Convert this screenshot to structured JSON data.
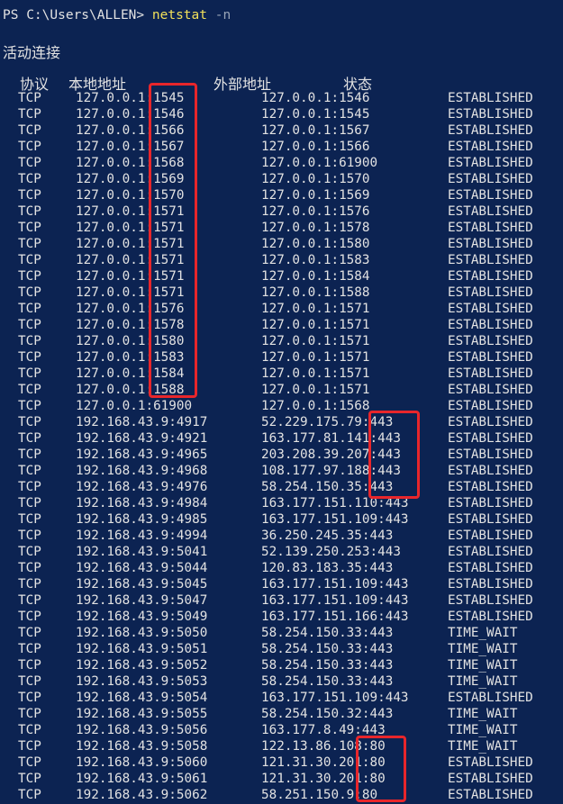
{
  "prompt": {
    "path": "PS C:\\Users\\ALLEN> ",
    "command": "netstat",
    "option": " -n"
  },
  "section_title": "活动连接",
  "headers": {
    "proto": "协议",
    "local": "本地地址",
    "foreign": "外部地址",
    "state": "状态"
  },
  "rows": [
    [
      "TCP",
      "127.0.0.1:1545",
      "127.0.0.1:1546",
      "ESTABLISHED"
    ],
    [
      "TCP",
      "127.0.0.1:1546",
      "127.0.0.1:1545",
      "ESTABLISHED"
    ],
    [
      "TCP",
      "127.0.0.1:1566",
      "127.0.0.1:1567",
      "ESTABLISHED"
    ],
    [
      "TCP",
      "127.0.0.1:1567",
      "127.0.0.1:1566",
      "ESTABLISHED"
    ],
    [
      "TCP",
      "127.0.0.1:1568",
      "127.0.0.1:61900",
      "ESTABLISHED"
    ],
    [
      "TCP",
      "127.0.0.1:1569",
      "127.0.0.1:1570",
      "ESTABLISHED"
    ],
    [
      "TCP",
      "127.0.0.1:1570",
      "127.0.0.1:1569",
      "ESTABLISHED"
    ],
    [
      "TCP",
      "127.0.0.1:1571",
      "127.0.0.1:1576",
      "ESTABLISHED"
    ],
    [
      "TCP",
      "127.0.0.1:1571",
      "127.0.0.1:1578",
      "ESTABLISHED"
    ],
    [
      "TCP",
      "127.0.0.1:1571",
      "127.0.0.1:1580",
      "ESTABLISHED"
    ],
    [
      "TCP",
      "127.0.0.1:1571",
      "127.0.0.1:1583",
      "ESTABLISHED"
    ],
    [
      "TCP",
      "127.0.0.1:1571",
      "127.0.0.1:1584",
      "ESTABLISHED"
    ],
    [
      "TCP",
      "127.0.0.1:1571",
      "127.0.0.1:1588",
      "ESTABLISHED"
    ],
    [
      "TCP",
      "127.0.0.1:1576",
      "127.0.0.1:1571",
      "ESTABLISHED"
    ],
    [
      "TCP",
      "127.0.0.1:1578",
      "127.0.0.1:1571",
      "ESTABLISHED"
    ],
    [
      "TCP",
      "127.0.0.1:1580",
      "127.0.0.1:1571",
      "ESTABLISHED"
    ],
    [
      "TCP",
      "127.0.0.1:1583",
      "127.0.0.1:1571",
      "ESTABLISHED"
    ],
    [
      "TCP",
      "127.0.0.1:1584",
      "127.0.0.1:1571",
      "ESTABLISHED"
    ],
    [
      "TCP",
      "127.0.0.1:1588",
      "127.0.0.1:1571",
      "ESTABLISHED"
    ],
    [
      "TCP",
      "127.0.0.1:61900",
      "127.0.0.1:1568",
      "ESTABLISHED"
    ],
    [
      "TCP",
      "192.168.43.9:4917",
      "52.229.175.79:443",
      "ESTABLISHED"
    ],
    [
      "TCP",
      "192.168.43.9:4921",
      "163.177.81.141:443",
      "ESTABLISHED"
    ],
    [
      "TCP",
      "192.168.43.9:4965",
      "203.208.39.207:443",
      "ESTABLISHED"
    ],
    [
      "TCP",
      "192.168.43.9:4968",
      "108.177.97.188:443",
      "ESTABLISHED"
    ],
    [
      "TCP",
      "192.168.43.9:4976",
      "58.254.150.35:443",
      "ESTABLISHED"
    ],
    [
      "TCP",
      "192.168.43.9:4984",
      "163.177.151.110:443",
      "ESTABLISHED"
    ],
    [
      "TCP",
      "192.168.43.9:4985",
      "163.177.151.109:443",
      "ESTABLISHED"
    ],
    [
      "TCP",
      "192.168.43.9:4994",
      "36.250.245.35:443",
      "ESTABLISHED"
    ],
    [
      "TCP",
      "192.168.43.9:5041",
      "52.139.250.253:443",
      "ESTABLISHED"
    ],
    [
      "TCP",
      "192.168.43.9:5044",
      "120.83.183.35:443",
      "ESTABLISHED"
    ],
    [
      "TCP",
      "192.168.43.9:5045",
      "163.177.151.109:443",
      "ESTABLISHED"
    ],
    [
      "TCP",
      "192.168.43.9:5047",
      "163.177.151.109:443",
      "ESTABLISHED"
    ],
    [
      "TCP",
      "192.168.43.9:5049",
      "163.177.151.166:443",
      "ESTABLISHED"
    ],
    [
      "TCP",
      "192.168.43.9:5050",
      "58.254.150.33:443",
      "TIME_WAIT"
    ],
    [
      "TCP",
      "192.168.43.9:5051",
      "58.254.150.33:443",
      "TIME_WAIT"
    ],
    [
      "TCP",
      "192.168.43.9:5052",
      "58.254.150.33:443",
      "TIME_WAIT"
    ],
    [
      "TCP",
      "192.168.43.9:5053",
      "58.254.150.33:443",
      "TIME_WAIT"
    ],
    [
      "TCP",
      "192.168.43.9:5054",
      "163.177.151.109:443",
      "ESTABLISHED"
    ],
    [
      "TCP",
      "192.168.43.9:5055",
      "58.254.150.32:443",
      "TIME_WAIT"
    ],
    [
      "TCP",
      "192.168.43.9:5056",
      "163.177.8.49:443",
      "TIME_WAIT"
    ],
    [
      "TCP",
      "192.168.43.9:5058",
      "122.13.86.108:80",
      "TIME_WAIT"
    ],
    [
      "TCP",
      "192.168.43.9:5060",
      "121.31.30.201:80",
      "ESTABLISHED"
    ],
    [
      "TCP",
      "192.168.43.9:5061",
      "121.31.30.201:80",
      "ESTABLISHED"
    ],
    [
      "TCP",
      "192.168.43.9:5062",
      "58.251.150.9:80",
      "ESTABLISHED"
    ]
  ],
  "highlight_color": "#e8262b"
}
